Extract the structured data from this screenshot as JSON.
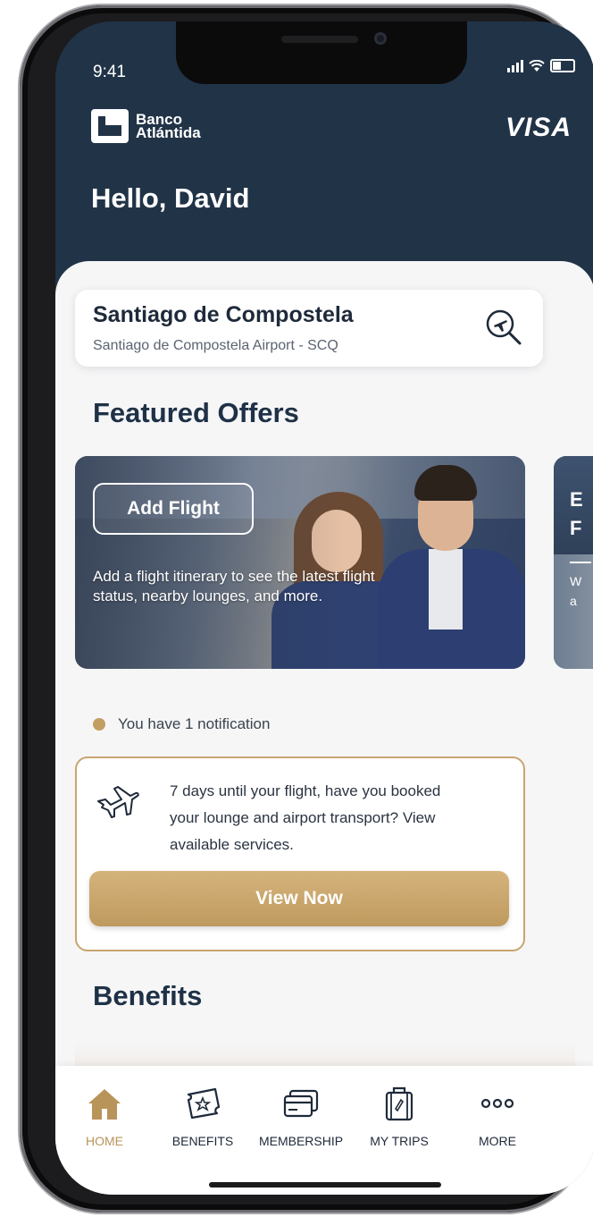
{
  "status_bar": {
    "time": "9:41"
  },
  "header": {
    "bank_name_line1": "Banco",
    "bank_name_line2": "Atlántida",
    "card_brand": "VISA",
    "greeting": "Hello, David"
  },
  "location": {
    "city": "Santiago de Compostela",
    "airport": "Santiago de Compostela Airport - SCQ",
    "search_icon": "airplane-search-icon"
  },
  "featured_offers": {
    "title": "Featured Offers",
    "card": {
      "button_label": "Add Flight",
      "description": "Add a flight itinerary to see the latest flight status, nearby lounges, and more."
    },
    "next_card_peek": {
      "line1": "E",
      "line2": "F",
      "small1": "W",
      "small2": "a"
    }
  },
  "notifications": {
    "summary": "You have 1 notification",
    "dot_color": "#c29e62",
    "card": {
      "icon": "airplane-icon",
      "message": "7 days until your flight, have you booked your lounge and airport transport? View available services.",
      "action_label": "View Now",
      "border_color": "#c8a470"
    }
  },
  "benefits": {
    "title": "Benefits"
  },
  "tab_bar": {
    "accent_color": "#b8945a",
    "tabs": [
      {
        "label": "HOME",
        "icon": "home-icon",
        "active": true
      },
      {
        "label": "BENEFITS",
        "icon": "ticket-icon",
        "active": false
      },
      {
        "label": "MEMBERSHIP",
        "icon": "cards-icon",
        "active": false
      },
      {
        "label": "MY TRIPS",
        "icon": "luggage-icon",
        "active": false
      },
      {
        "label": "MORE",
        "icon": "more-icon",
        "active": false
      }
    ]
  }
}
